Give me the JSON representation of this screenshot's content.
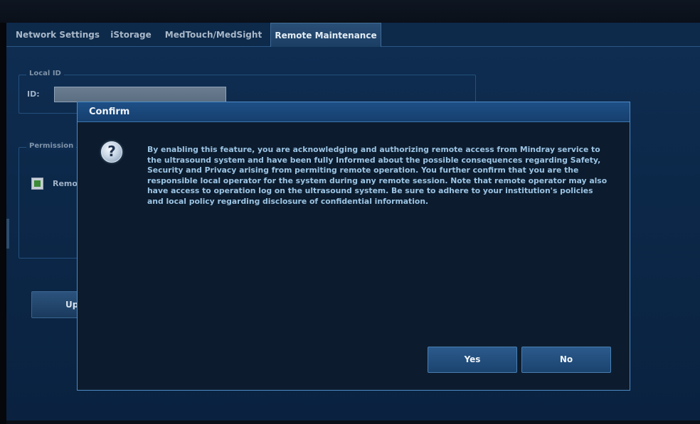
{
  "tabs": [
    {
      "label": "Network Settings"
    },
    {
      "label": "iStorage"
    },
    {
      "label": "MedTouch/MedSight"
    },
    {
      "label": "Remote Maintenance",
      "active": true
    }
  ],
  "local_id": {
    "legend": "Local ID",
    "id_label": "ID:",
    "id_value": ""
  },
  "permission": {
    "legend": "Permission",
    "remote_label_visible": "Remo",
    "checked": true
  },
  "update_button": {
    "label_visible": "Up"
  },
  "dialog": {
    "title": "Confirm",
    "icon": "question-icon",
    "message": "By enabling this feature, you are acknowledging and authorizing remote access from Mindray service to the ultrasound system and have been fully Informed about the possible consequences regarding Safety, Security and Privacy arising from permiting remote operation. You further confirm that you are the responsible local operator for the system during any remote session. Note that remote operator may also have access to operation log on the ultrasound system. Be sure to adhere to your institution's policies and local policy regarding disclosure of confidential information.",
    "yes_label": "Yes",
    "no_label": "No"
  },
  "colors": {
    "panel_background": "#0c2849",
    "dialog_background": "#0c1c2e",
    "dialog_border": "#4f8cc6",
    "message_text": "#9cc4e4",
    "checkbox_fill": "#3c8b36"
  }
}
